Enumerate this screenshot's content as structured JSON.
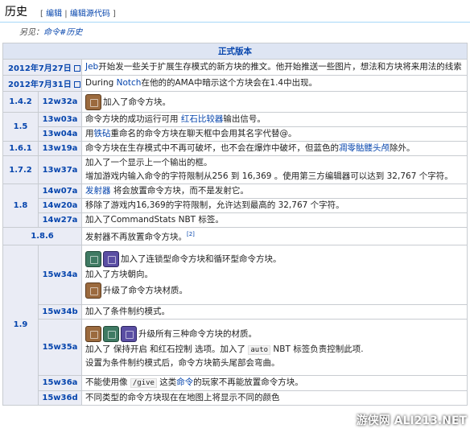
{
  "header": {
    "title": "历史",
    "open_bracket": "[",
    "edit": "编辑",
    "sep": "|",
    "edit_source": "编辑源代码",
    "close_bracket": "]"
  },
  "see_also": {
    "prefix": "另见：",
    "link": "命令#历史"
  },
  "table": {
    "heading": "正式版本",
    "rows": {
      "d1": {
        "date": "2012年7月27日",
        "a": "Jeb",
        "b": "开始发一些关于扩展生存模式的新方块的推文。他开始推送一些图片，想法和方块将来用法的线索"
      },
      "d2": {
        "date": "2012年7月31日",
        "a": "During ",
        "b": "Notch",
        "c": "在他的的AMA中暗示这个方块会在1.4中出现。"
      },
      "v142": {
        "ver": "1.4.2",
        "snap": "12w32a",
        "text": "加入了命令方块。"
      },
      "v15": {
        "ver": "1.5",
        "snap1": "13w03a",
        "t1a": "命令方块的成功运行可用 ",
        "t1b": "红石比较器",
        "t1c": "输出信号。",
        "snap2": "13w04a",
        "t2a": "用",
        "t2b": "铁砧",
        "t2c": "重命名的命令方块在聊天框中会用其名字代替@。"
      },
      "v161": {
        "ver": "1.6.1",
        "snap": "13w19a",
        "ta": "命令方块在生存模式中不再可破坏，也不会在爆炸中破坏，但蓝色的",
        "tb": "凋零骷髅头颅",
        "tc": "除外。"
      },
      "v172": {
        "ver": "1.7.2",
        "snap": "13w37a",
        "t1": "加入了一个显示上一个输出的框。",
        "t2": "增加游戏内输入命令的字符限制从256 到 16,369 。使用第三方编辑器可以达到 32,767 个字符。"
      },
      "v18": {
        "ver": "1.8",
        "snap1": "14w07a",
        "t1a": "发射器",
        "t1b": " 将会放置命令方块，而不是发射它。",
        "snap2": "14w20a",
        "t2": "移除了游戏内16,369的字符限制，允许达到最高的 32,767 个字符。",
        "snap3": "14w27a",
        "t3": "加入了CommandStats NBT 标签。"
      },
      "v186": {
        "ver": "1.8.6",
        "t": "发射器不再放置命令方块。",
        "ref": "[2]"
      },
      "v19": {
        "ver": "1.9",
        "s1": "15w34a",
        "s1t1": "加入了连锁型命令方块和循环型命令方块。",
        "s1t2": "加入了方块朝向。",
        "s1t3": "升级了命令方块材质。",
        "s2": "15w34b",
        "s2t": "加入了条件制约模式。",
        "s3": "15w35a",
        "s3t1": "升级所有三种命令方块的材质。",
        "s3t2a": "加入了 保持开启 和红石控制 选项。加入了 ",
        "s3t2code": "auto",
        "s3t2b": " NBT 标签负责控制此项.",
        "s3t3": "设置为条件制约模式后，命令方块箭头尾部会弯曲。",
        "s4": "15w36a",
        "s4ta": "不能使用像 ",
        "s4code": "/give",
        "s4tb": " 这类",
        "s4link": "命令",
        "s4tc": "的玩家不再能放置命令方块。",
        "s5": "15w36d",
        "s5t": "不同类型的命令方块现在在地图上将显示不同的颜色"
      }
    }
  },
  "watermark": "游侠网 ALI213.NET",
  "icons": {
    "impulse": "impulse-command-block-icon",
    "chain": "chain-command-block-icon",
    "repeat": "repeating-command-block-icon"
  },
  "colors": {
    "link": "#0645ad",
    "header_bg": "#dee5f3",
    "version_bg": "#eaecf5"
  }
}
